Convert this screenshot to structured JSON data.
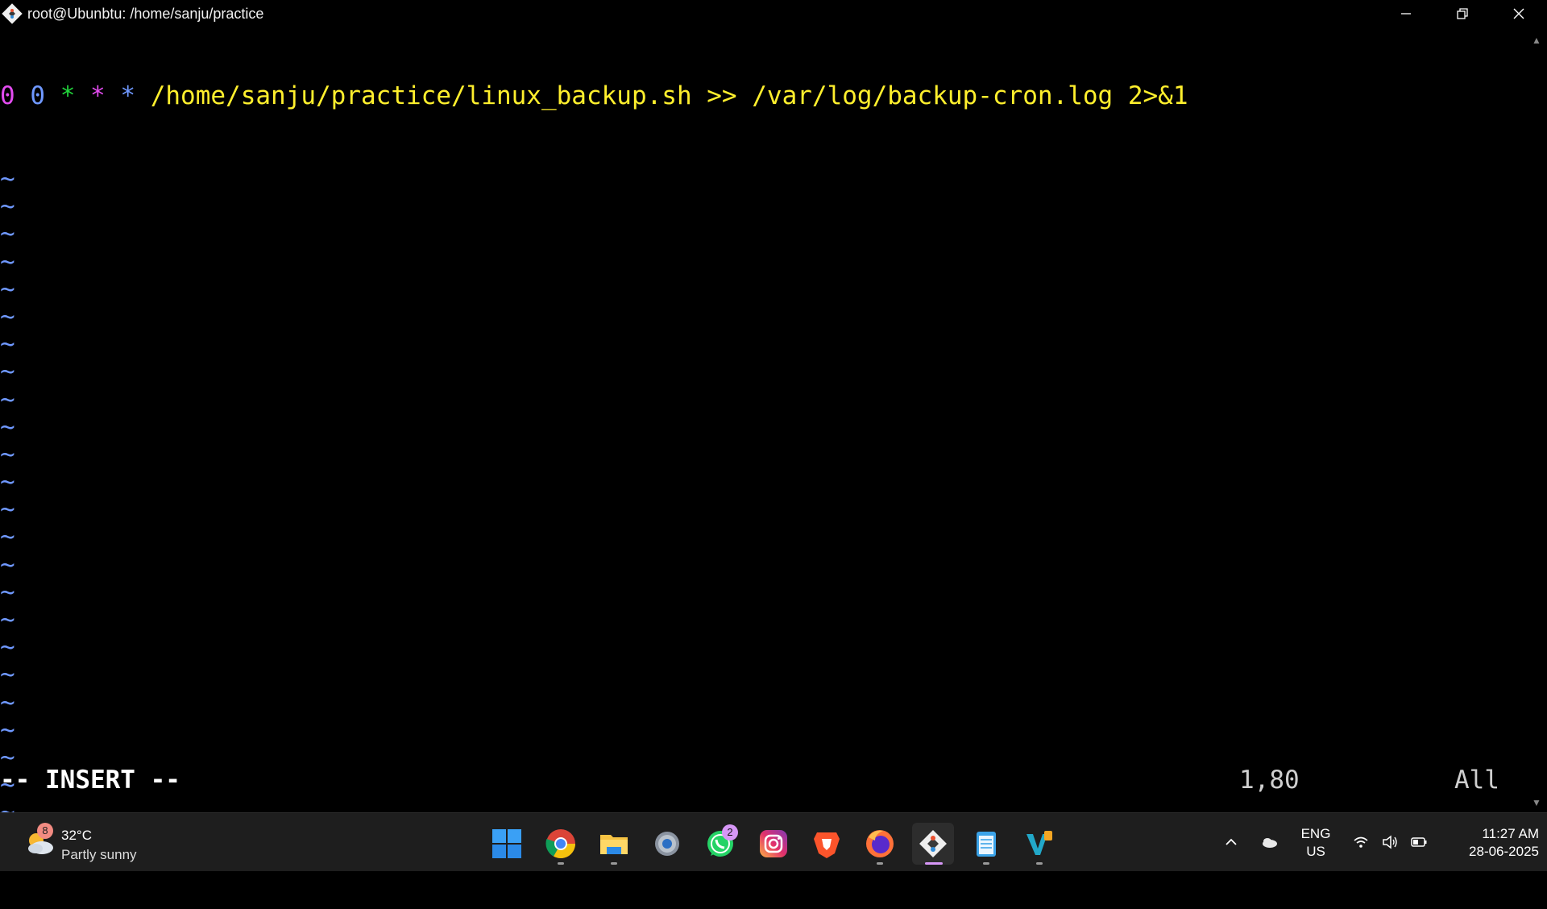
{
  "window": {
    "title": "root@Ubunbtu: /home/sanju/practice"
  },
  "editor": {
    "line1": {
      "min": "0",
      "hour": "0",
      "dom": "*",
      "month": "*",
      "dow": "*",
      "command": "/home/sanju/practice/linux_backup.sh >> /var/log/backup-cron.log 2>&1"
    },
    "empty_line_marker": "~",
    "mode": "-- INSERT --",
    "cursor_position": "1,80",
    "scroll_position": "All"
  },
  "taskbar": {
    "weather": {
      "badge": "8",
      "temperature": "32°C",
      "condition": "Partly sunny"
    },
    "apps": [
      {
        "name": "start",
        "icon": "windows-icon"
      },
      {
        "name": "chrome",
        "icon": "chrome-icon"
      },
      {
        "name": "file-explorer",
        "icon": "folder-icon"
      },
      {
        "name": "settings",
        "icon": "gear-icon"
      },
      {
        "name": "whatsapp",
        "icon": "whatsapp-icon",
        "badge": "2"
      },
      {
        "name": "instagram",
        "icon": "instagram-icon"
      },
      {
        "name": "brave",
        "icon": "brave-icon"
      },
      {
        "name": "firefox",
        "icon": "firefox-icon"
      },
      {
        "name": "git-bash",
        "icon": "git-icon"
      },
      {
        "name": "notepad",
        "icon": "notepad-icon"
      },
      {
        "name": "vscode",
        "icon": "vs-icon"
      }
    ],
    "language": {
      "line1": "ENG",
      "line2": "US"
    },
    "clock": {
      "time": "11:27 AM",
      "date": "28-06-2025"
    }
  },
  "colors": {
    "terminal_bg": "#000000",
    "command_yellow": "#ffef2d",
    "tilde_blue": "#6f98ff",
    "magenta": "#e34cf0",
    "green": "#22d63c",
    "taskbar_bg": "#1e1e1e"
  }
}
